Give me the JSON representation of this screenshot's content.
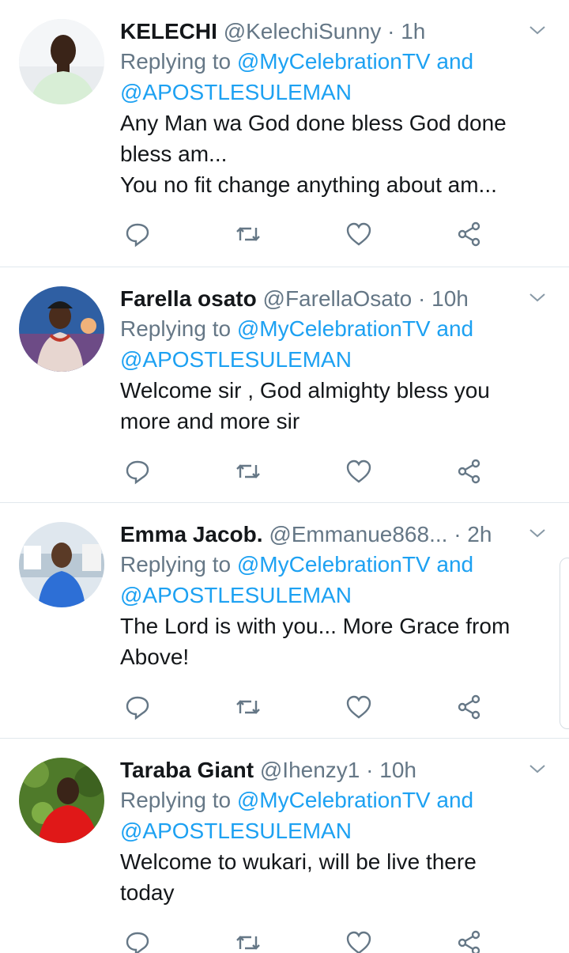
{
  "tweets": [
    {
      "name": "KELECHI",
      "handle": "@KelechiSunny",
      "dot": "·",
      "time": "1h",
      "replying_prefix": "Replying to",
      "replying_to_1": "@MyCelebrationTV and",
      "replying_to_2": "@APOSTLESULEMAN",
      "text": "Any Man wa God done bless God done\nbless am...\nYou no fit change anything about am..."
    },
    {
      "name": "Farella osato",
      "handle": "@FarellaOsato",
      "dot": "·",
      "time": "10h",
      "replying_prefix": "Replying to",
      "replying_to_1": "@MyCelebrationTV and",
      "replying_to_2": "@APOSTLESULEMAN",
      "text": "Welcome sir , God almighty bless you\nmore and more sir"
    },
    {
      "name": "Emma Jacob.",
      "handle": "@Emmanue868...",
      "dot": "·",
      "time": "2h",
      "replying_prefix": "Replying to",
      "replying_to_1": "@MyCelebrationTV and",
      "replying_to_2": "@APOSTLESULEMAN",
      "text": "The Lord is with you... More Grace from\nAbove!"
    },
    {
      "name": "Taraba Giant",
      "handle": "@Ihenzy1",
      "dot": "·",
      "time": "10h",
      "replying_prefix": "Replying to",
      "replying_to_1": "@MyCelebrationTV and",
      "replying_to_2": "@APOSTLESULEMAN",
      "text": "Welcome to wukari, will be live there\ntoday"
    }
  ],
  "icons": {
    "reply": "reply-icon",
    "retweet": "retweet-icon",
    "like": "heart-icon",
    "share": "share-icon",
    "menu": "chevron-down-icon"
  },
  "colors": {
    "link": "#1da1f2",
    "muted": "#657786",
    "text": "#14171a",
    "divider": "#e1e8ed"
  }
}
